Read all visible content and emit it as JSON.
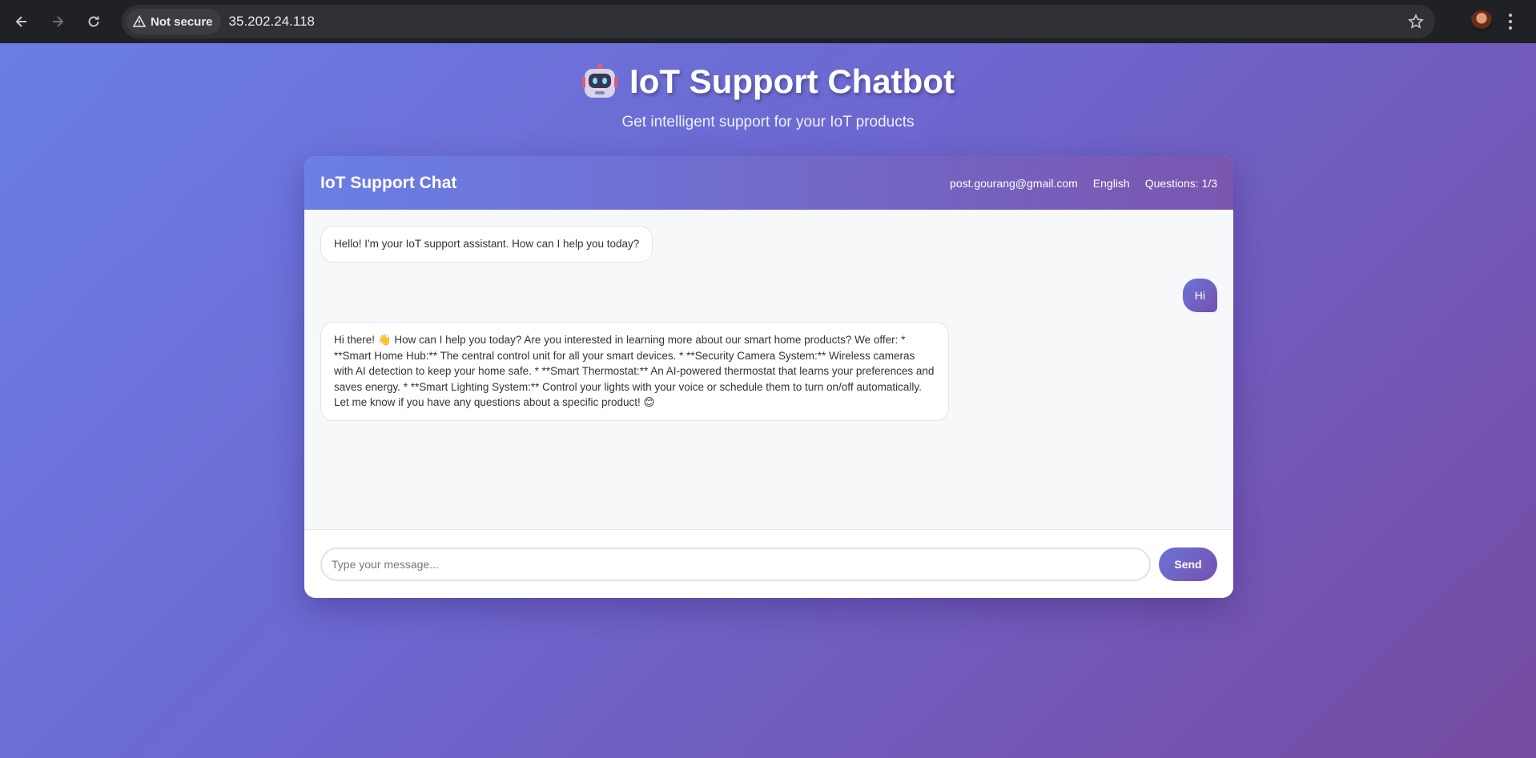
{
  "browser": {
    "security_label": "Not secure",
    "url": "35.202.24.118"
  },
  "header": {
    "title": "IoT Support Chatbot",
    "subtitle": "Get intelligent support for your IoT products"
  },
  "chat": {
    "title": "IoT Support Chat",
    "user_email": "post.gourang@gmail.com",
    "language": "English",
    "questions": "Questions: 1/3",
    "messages": [
      {
        "role": "bot",
        "text": "Hello! I'm your IoT support assistant. How can I help you today?"
      },
      {
        "role": "user",
        "text": "Hi"
      },
      {
        "role": "bot",
        "text": "Hi there! 👋 How can I help you today? Are you interested in learning more about our smart home products? We offer: * **Smart Home Hub:** The central control unit for all your smart devices. * **Security Camera System:** Wireless cameras with AI detection to keep your home safe. * **Smart Thermostat:** An AI-powered thermostat that learns your preferences and saves energy. * **Smart Lighting System:** Control your lights with your voice or schedule them to turn on/off automatically. Let me know if you have any questions about a specific product! 😊"
      }
    ],
    "input_placeholder": "Type your message...",
    "input_value": "",
    "send_label": "Send"
  }
}
